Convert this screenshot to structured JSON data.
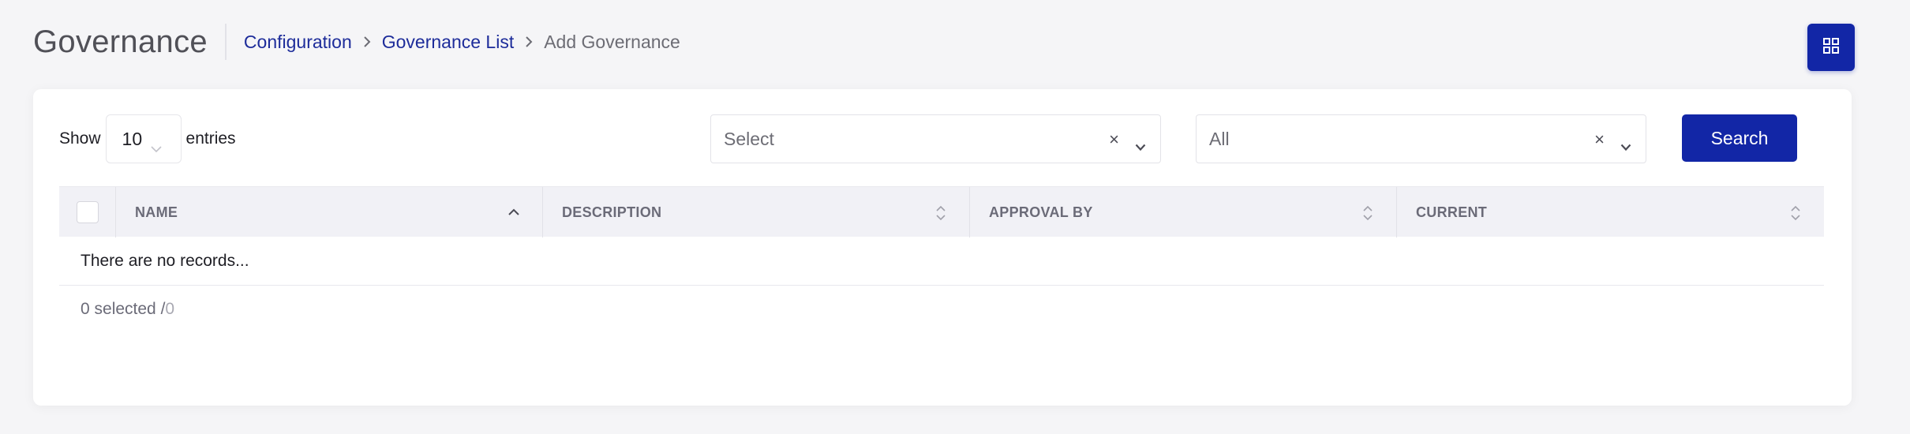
{
  "header": {
    "title": "Governance",
    "breadcrumb": [
      {
        "label": "Configuration"
      },
      {
        "label": "Governance List"
      },
      {
        "label": "Add Governance"
      }
    ],
    "grid_icon": "grid-icon"
  },
  "toolbar": {
    "show_label": "Show",
    "entries_value": "10",
    "entries_label": "entries",
    "filter1": {
      "placeholder": "Select",
      "clear": "×"
    },
    "filter2": {
      "value": "All",
      "clear": "×"
    },
    "search_label": "Search"
  },
  "table": {
    "columns": [
      {
        "label": "NAME",
        "sort": "ascending"
      },
      {
        "label": "DESCRIPTION",
        "sort": "none"
      },
      {
        "label": "APPROVAL BY",
        "sort": "none"
      },
      {
        "label": "CURRENT",
        "sort": "none"
      }
    ],
    "empty_message": "There are no records...",
    "footer": {
      "selected_text": "0 selected / ",
      "total": "0"
    }
  },
  "colors": {
    "accent": "#1226a6",
    "link": "#1d2c9a"
  }
}
